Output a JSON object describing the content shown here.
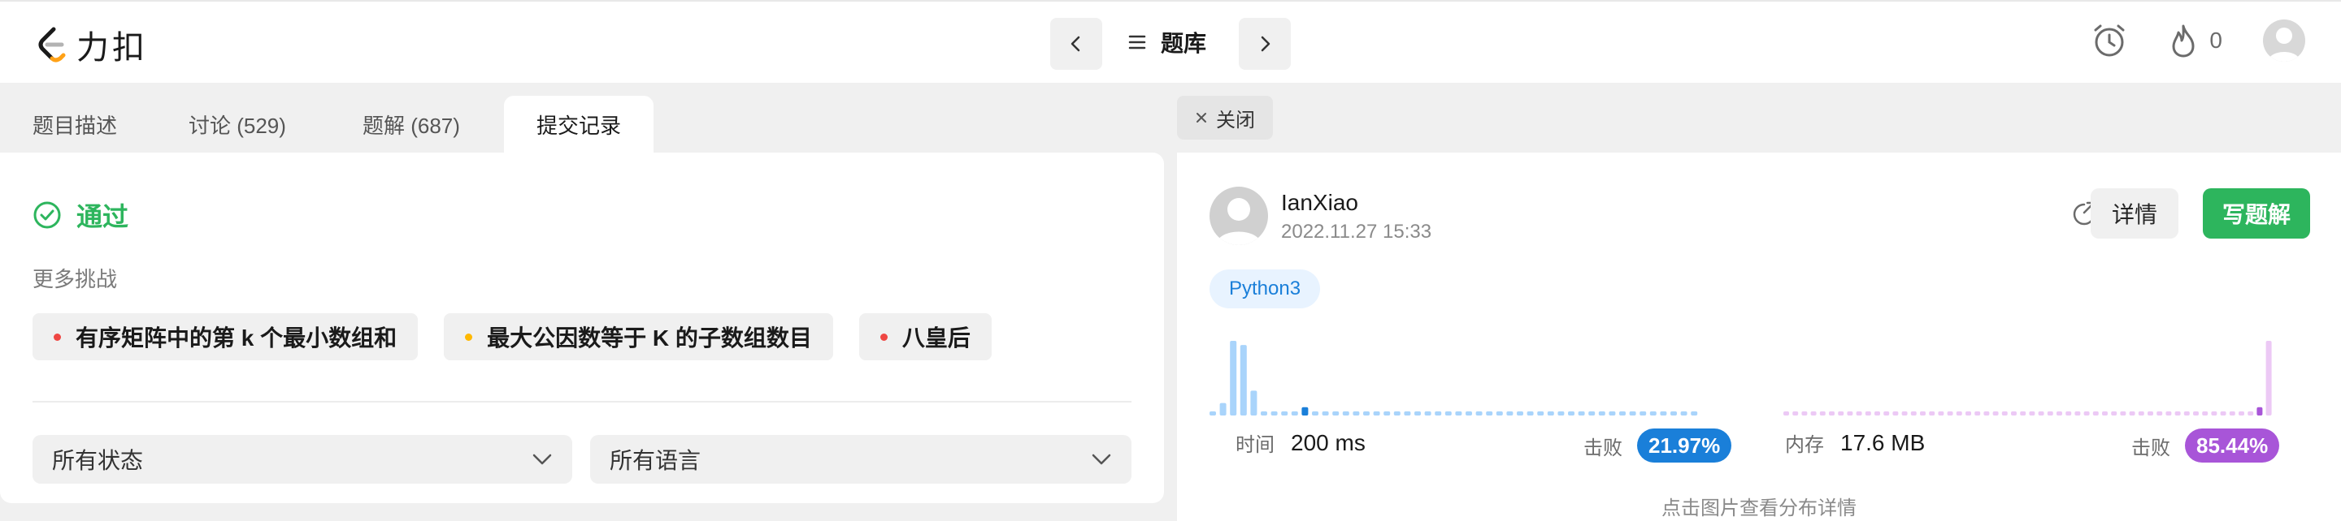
{
  "header": {
    "brand": "力扣",
    "problems_label": "题库",
    "streak_count": "0"
  },
  "tabs": [
    {
      "label": "题目描述"
    },
    {
      "label": "讨论 (529)"
    },
    {
      "label": "题解 (687)"
    },
    {
      "label": "提交记录"
    }
  ],
  "result": {
    "status": "通过",
    "more_label": "更多挑战",
    "challenges": [
      {
        "title": "有序矩阵中的第 k 个最小数组和",
        "color": "#ef4743"
      },
      {
        "title": "最大公因数等于 K 的子数组数目",
        "color": "#ffb800"
      },
      {
        "title": "八皇后",
        "color": "#ef4743"
      }
    ],
    "filters": {
      "status": "所有状态",
      "language": "所有语言"
    }
  },
  "submission": {
    "close_label": "关闭",
    "user": "IanXiao",
    "datetime": "2022.11.27 15:33",
    "detail_label": "详情",
    "write_label": "写题解",
    "language": "Python3",
    "runtime": {
      "label": "时间",
      "value": "200 ms",
      "beat_label": "击败",
      "beat": "21.97%",
      "color": "#1a7fd9"
    },
    "memory": {
      "label": "内存",
      "value": "17.6 MB",
      "beat_label": "击败",
      "beat": "85.44%",
      "color": "#a855d8"
    },
    "hint": "点击图片查看分布详情"
  },
  "chart_data": [
    {
      "type": "bar",
      "name": "runtime-distribution",
      "values": [
        1,
        3,
        18,
        17,
        6,
        1,
        1,
        1,
        1,
        2,
        1,
        1,
        1,
        1,
        1,
        1,
        1,
        1,
        1,
        1,
        1,
        1,
        1,
        1,
        1,
        1,
        1,
        1,
        1,
        1,
        1,
        1,
        1,
        1,
        1,
        1,
        1,
        1,
        1,
        1,
        1,
        1,
        1,
        1,
        1,
        1,
        1,
        1
      ],
      "highlight_index": 9,
      "color": "#a9d4fb",
      "highlight_color": "#1a7fd9"
    },
    {
      "type": "bar",
      "name": "memory-distribution",
      "values": [
        1,
        1,
        1,
        1,
        1,
        1,
        1,
        1,
        1,
        1,
        1,
        1,
        1,
        1,
        1,
        1,
        1,
        1,
        1,
        1,
        1,
        1,
        1,
        1,
        1,
        1,
        1,
        1,
        1,
        1,
        1,
        1,
        1,
        1,
        1,
        1,
        1,
        1,
        1,
        1,
        1,
        1,
        1,
        1,
        1,
        1,
        1,
        1,
        1,
        1,
        1,
        1,
        2,
        18
      ],
      "highlight_index": 52,
      "color": "#ecc9f5",
      "highlight_color": "#a855d8"
    }
  ]
}
